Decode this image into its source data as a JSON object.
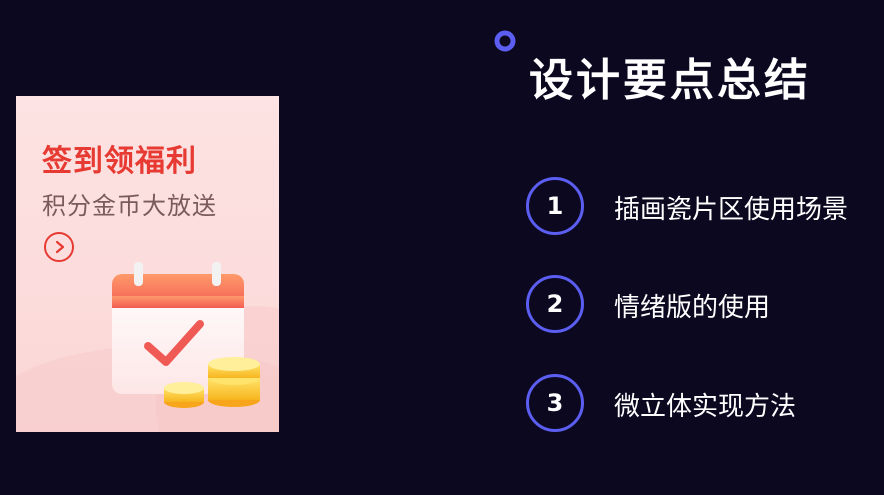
{
  "card": {
    "title": "签到领福利",
    "subtitle": "积分金币大放送"
  },
  "heading": "设计要点总结",
  "items": [
    {
      "number": "1",
      "label": "插画瓷片区使用场景"
    },
    {
      "number": "2",
      "label": "情绪版的使用"
    },
    {
      "number": "3",
      "label": "微立体实现方法"
    }
  ],
  "colors": {
    "background": "#0b0820",
    "accent": "#5b5ef0",
    "card_title": "#e63a32",
    "card_bg": "#fde3e3"
  },
  "icons": [
    "ring-deco-icon",
    "arrow-right-icon",
    "calendar-check-icon",
    "coins-icon"
  ]
}
